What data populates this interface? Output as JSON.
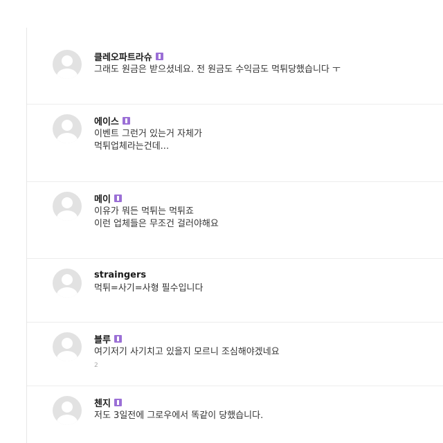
{
  "comments": [
    {
      "author": "클레오파트라슈",
      "level_badge": true,
      "lines": [
        "그래도 원금은 받으셨네요. 전 원금도 수익금도 먹튀당했습니다 ㅜ"
      ]
    },
    {
      "author": "에이스",
      "level_badge": true,
      "lines": [
        "이벤트 그런거 있는거 자체가",
        "먹튀업체라는건데..."
      ]
    },
    {
      "author": "메이",
      "level_badge": true,
      "lines": [
        "이유가 뭐든 먹튀는 먹튀죠",
        "이런 업체들은 무조건 걸러야해요"
      ]
    },
    {
      "author": "straingers",
      "level_badge": false,
      "lines": [
        "먹튀=사기=사형 필수입니다"
      ]
    },
    {
      "author": "블루",
      "level_badge": true,
      "lines": [
        "여기저기 사기치고 있을지 모르니 조심해야겠네요"
      ],
      "extra": "2"
    },
    {
      "author": "첸지",
      "level_badge": true,
      "lines": [
        "저도 3일전에 그로우에서 똑같이 당했습니다."
      ]
    }
  ]
}
